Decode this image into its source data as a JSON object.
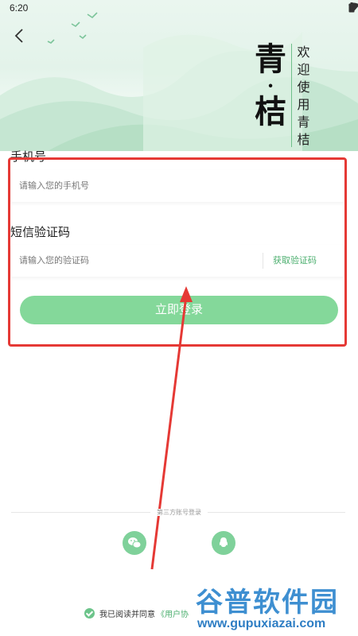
{
  "status_bar": {
    "time": "6:20",
    "icons": [
      "wifi-icon",
      "battery-icon"
    ]
  },
  "header": {
    "brand_top": "青",
    "brand_dot": "·",
    "brand_bottom": "桔",
    "slogan": "欢迎使用青桔小说"
  },
  "form": {
    "phone_label": "手机号",
    "phone_placeholder": "请输入您的手机号",
    "sms_label": "短信验证码",
    "sms_placeholder": "请输入您的验证码",
    "get_code": "获取验证码",
    "login": "立即登录"
  },
  "third_party": {
    "label": "第三方账号登录",
    "providers": [
      "wechat-icon",
      "qq-icon"
    ]
  },
  "agreement": {
    "text": "我已阅读并同意",
    "link": "《用户协"
  },
  "watermark": {
    "title": "谷普软件园",
    "url": "www.gupuxiazai.com"
  },
  "colors": {
    "accent": "#84d89a",
    "link": "#4caf6f",
    "annotation": "#e53935"
  }
}
